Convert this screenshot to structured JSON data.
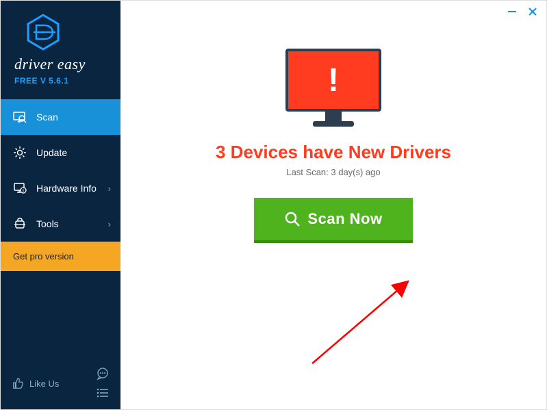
{
  "brand": {
    "name": "driver easy",
    "version": "FREE V 5.6.1"
  },
  "nav": {
    "scan": "Scan",
    "update": "Update",
    "hardware": "Hardware Info",
    "tools": "Tools",
    "pro": "Get pro version",
    "like": "Like Us"
  },
  "main": {
    "headline": "3 Devices have New Drivers",
    "last_scan": "Last Scan: 3 day(s) ago",
    "scan_button": "Scan Now"
  }
}
